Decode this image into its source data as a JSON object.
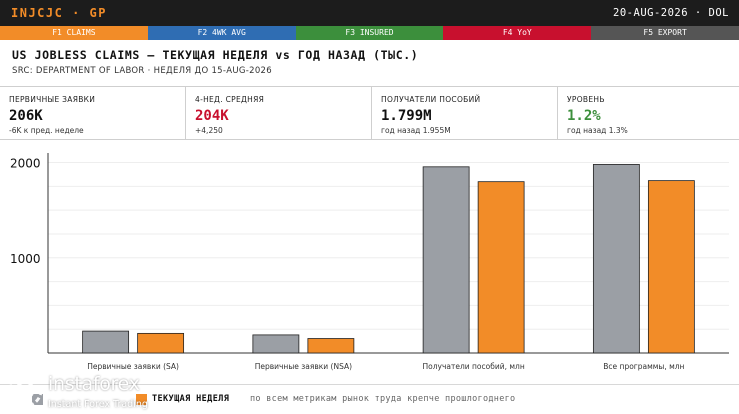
{
  "header": {
    "ticker": "INJCJC · GP",
    "date": "20-AUG-2026 · DOL"
  },
  "function_keys": [
    {
      "label": "F1 CLAIMS",
      "color": "#f28c28"
    },
    {
      "label": "F2 4WK AVG",
      "color": "#2f6db3"
    },
    {
      "label": "F3 INSURED",
      "color": "#3c8f3c"
    },
    {
      "label": "F4 YoY",
      "color": "#c8102e"
    },
    {
      "label": "F5 EXPORT",
      "color": "#555555"
    }
  ],
  "title": "US JOBLESS CLAIMS — ТЕКУЩАЯ НЕДЕЛЯ vs ГОД НАЗАД (ТЫС.)",
  "subtitle": "SRC: DEPARTMENT OF LABOR · НЕДЕЛЯ ДО 15-AUG-2026",
  "stats": [
    {
      "label": "ПЕРВИЧНЫЕ ЗАЯВКИ",
      "value": "206K",
      "value_color": "#111111",
      "sub": "-6K к пред. неделе"
    },
    {
      "label": "4-НЕД. СРЕДНЯЯ",
      "value": "204K",
      "value_color": "#c8102e",
      "sub": "+4,250"
    },
    {
      "label": "ПОЛУЧАТЕЛИ ПОСОБИЙ",
      "value": "1.799M",
      "value_color": "#111111",
      "sub": "год назад 1.955M"
    },
    {
      "label": "УРОВЕНЬ",
      "value": "1.2%",
      "value_color": "#3c8f3c",
      "sub": "год назад 1.3%"
    }
  ],
  "chart_data": {
    "type": "bar",
    "categories": [
      "Первичные заявки (SA)",
      "Первичные заявки (NSA)",
      "Получатели пособий, млн",
      "Все программы, млн"
    ],
    "series": [
      {
        "name": "",
        "color": "#9b9fa5",
        "values": [
          230,
          190,
          1955,
          1980
        ]
      },
      {
        "name": "ТЕКУЩАЯ НЕДЕЛЯ",
        "color": "#f28c28",
        "values": [
          206,
          152,
          1799,
          1810
        ]
      }
    ],
    "ylim": [
      0,
      2100
    ],
    "yticks": [
      1000,
      2000
    ],
    "ytick_labels": [
      "1000",
      "2000"
    ],
    "grid": true
  },
  "legend_note": "по всем метрикам рынок труда крепче прошлогоднего",
  "watermark": {
    "brand": "instaforex",
    "tagline": "Instant Forex Trading"
  }
}
